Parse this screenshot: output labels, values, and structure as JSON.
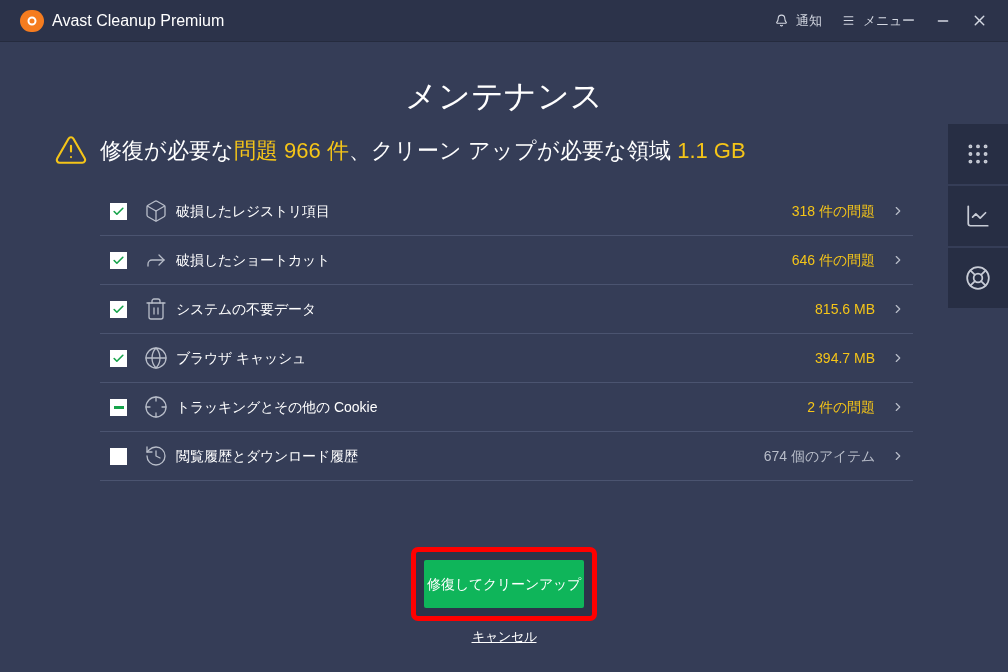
{
  "window": {
    "title": "Avast Cleanup Premium",
    "actions": [
      {
        "kind": "bell",
        "label": "通知"
      },
      {
        "kind": "menu",
        "label": "メニュー"
      }
    ]
  },
  "heading": "メンテナンス",
  "summary": [
    {
      "text": "修復が必要な",
      "highlight": false
    },
    {
      "text": "問題 966 件",
      "highlight": true
    },
    {
      "text": "、クリーン アップが必要な領域 ",
      "highlight": false
    },
    {
      "text": "1.1 GB",
      "highlight": true
    }
  ],
  "items": [
    {
      "kind": "cube",
      "label": "破損したレジストリ項目",
      "value": "318 件の問題",
      "warning": true,
      "checked": true
    },
    {
      "kind": "share",
      "label": "破損したショートカット",
      "value": "646 件の問題",
      "warning": true,
      "checked": true
    },
    {
      "kind": "trash",
      "label": "システムの不要データ",
      "value": "815.6 MB",
      "warning": true,
      "checked": true
    },
    {
      "kind": "globe",
      "label": "ブラウザ キャッシュ",
      "value": "394.7 MB",
      "warning": true,
      "checked": true
    },
    {
      "kind": "target",
      "label": "トラッキングとその他の Cookie",
      "value": "2 件の問題",
      "warning": true,
      "checked": true,
      "mixed": true
    },
    {
      "kind": "history",
      "label": "閲覧履歴とダウンロード履歴",
      "value": "674 個のアイテム",
      "warning": false,
      "checked": false
    }
  ],
  "side_tabs": [
    {
      "kind": "grid"
    },
    {
      "kind": "chart"
    },
    {
      "kind": "lifebuoy"
    }
  ],
  "primary_button": "修復してクリーンアップ",
  "cancel_link": "キャンセル"
}
